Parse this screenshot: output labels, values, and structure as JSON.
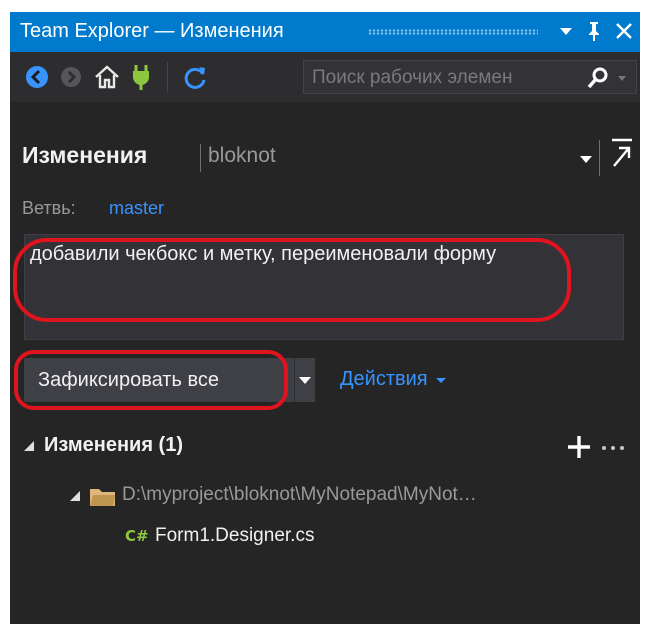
{
  "window": {
    "title": "Team Explorer — Изменения",
    "dropdown_glyph": "▾",
    "pin_glyph": "📌",
    "close_glyph": "✕"
  },
  "toolbar": {
    "icons": [
      "back-icon",
      "forward-icon",
      "home-icon",
      "connect-icon",
      "refresh-icon"
    ],
    "search_placeholder": "Поиск рабочих элемен",
    "search_icon": "search-icon"
  },
  "header": {
    "title": "Изменения",
    "repo": "bloknot"
  },
  "branch": {
    "label": "Ветвь:",
    "name": "master"
  },
  "commit": {
    "message": "добавили чекбокс и метку, переименовали форму",
    "button_label": "Зафиксировать все",
    "actions_label": "Действия"
  },
  "changes": {
    "title": "Изменения (1)",
    "folder_path": "D:\\myproject\\bloknot\\MyNotepad\\MyNot…",
    "file_name": "Form1.Designer.cs"
  },
  "colors": {
    "accent": "#007acc",
    "link": "#3794ff",
    "background": "#252526",
    "annotation": "#e0141e"
  }
}
